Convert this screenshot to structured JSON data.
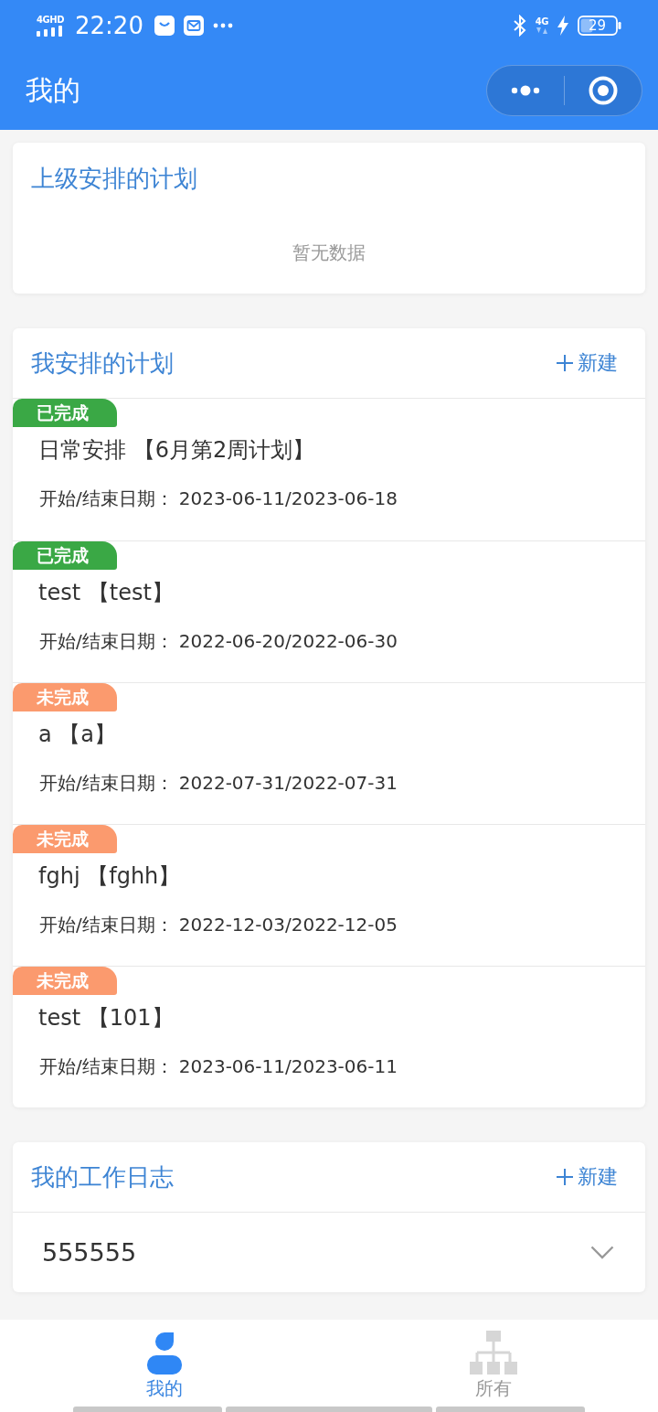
{
  "status_bar": {
    "network_label": "4GHD",
    "time": "22:20",
    "network_type": "4G",
    "battery": "29"
  },
  "header": {
    "title": "我的"
  },
  "assigned_plans": {
    "title": "上级安排的计划",
    "empty_text": "暂无数据"
  },
  "my_plans": {
    "title": "我安排的计划",
    "new_label": "新建",
    "items": [
      {
        "status": "已完成",
        "color": "#3aa845",
        "title": "日常安排 【6月第2周计划】",
        "date_label": "开始/结束日期：",
        "dates": "2023-06-11/2023-06-18"
      },
      {
        "status": "已完成",
        "color": "#3aa845",
        "title": "test 【test】",
        "date_label": "开始/结束日期：",
        "dates": "2022-06-20/2022-06-30"
      },
      {
        "status": "未完成",
        "color": "#fb9a6e",
        "title": "a 【a】",
        "date_label": "开始/结束日期：",
        "dates": "2022-07-31/2022-07-31"
      },
      {
        "status": "未完成",
        "color": "#fb9a6e",
        "title": "fghj 【fghh】",
        "date_label": "开始/结束日期：",
        "dates": "2022-12-03/2022-12-05"
      },
      {
        "status": "未完成",
        "color": "#fb9a6e",
        "title": "test 【101】",
        "date_label": "开始/结束日期：",
        "dates": "2023-06-11/2023-06-11"
      }
    ]
  },
  "work_log": {
    "title": "我的工作日志",
    "new_label": "新建",
    "entries": [
      {
        "text": "555555",
        "expanded": false
      }
    ]
  },
  "tab_bar": [
    {
      "label": "我的",
      "selected": true
    },
    {
      "label": "所有",
      "selected": false
    }
  ]
}
